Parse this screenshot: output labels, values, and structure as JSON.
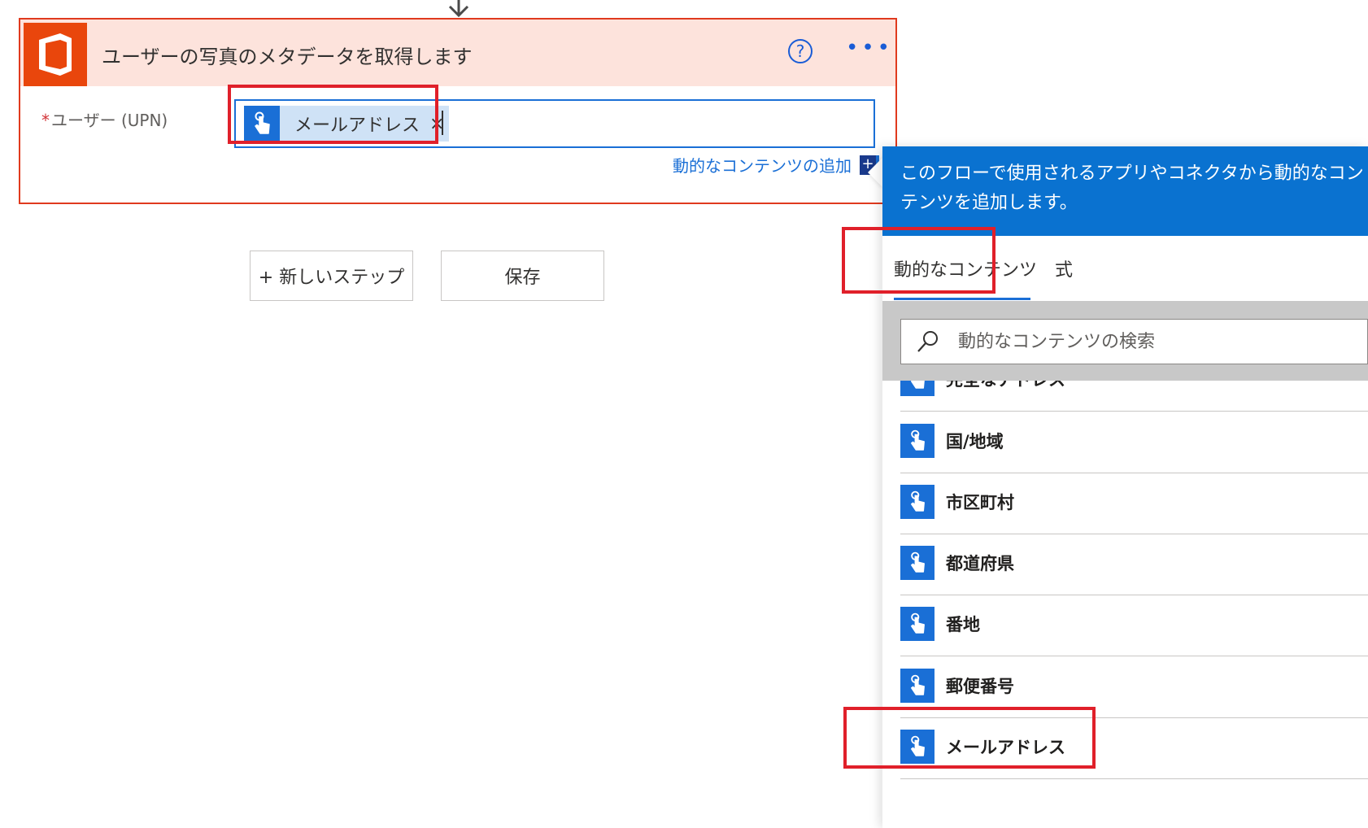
{
  "card": {
    "title": "ユーザーの写真のメタデータを取得します",
    "help_glyph": "?",
    "more_glyph": "•••",
    "field_required_mark": "*",
    "field_label": "ユーザー (UPN)",
    "token_label": "メールアドレス",
    "token_remove": "×",
    "add_dynamic_link": "動的なコンテンツの追加",
    "add_dynamic_glyph": "+"
  },
  "buttons": {
    "new_step": "+ 新しいステップ",
    "save": "保存"
  },
  "panel": {
    "description": "このフローで使用されるアプリやコネクタから動的なコンテンツを追加します。",
    "tabs": {
      "dynamic": "動的なコンテンツ",
      "expression": "式"
    },
    "search_placeholder": "動的なコンテンツの検索",
    "items": [
      {
        "label": "完全なアドレス"
      },
      {
        "label": "国/地域"
      },
      {
        "label": "市区町村"
      },
      {
        "label": "都道府県"
      },
      {
        "label": "番地"
      },
      {
        "label": "郵便番号"
      },
      {
        "label": "メールアドレス"
      }
    ]
  },
  "colors": {
    "accent": "#1a6fd6",
    "office": "#e9460c",
    "card_header": "#fde3dc",
    "highlight": "#e0202a"
  }
}
